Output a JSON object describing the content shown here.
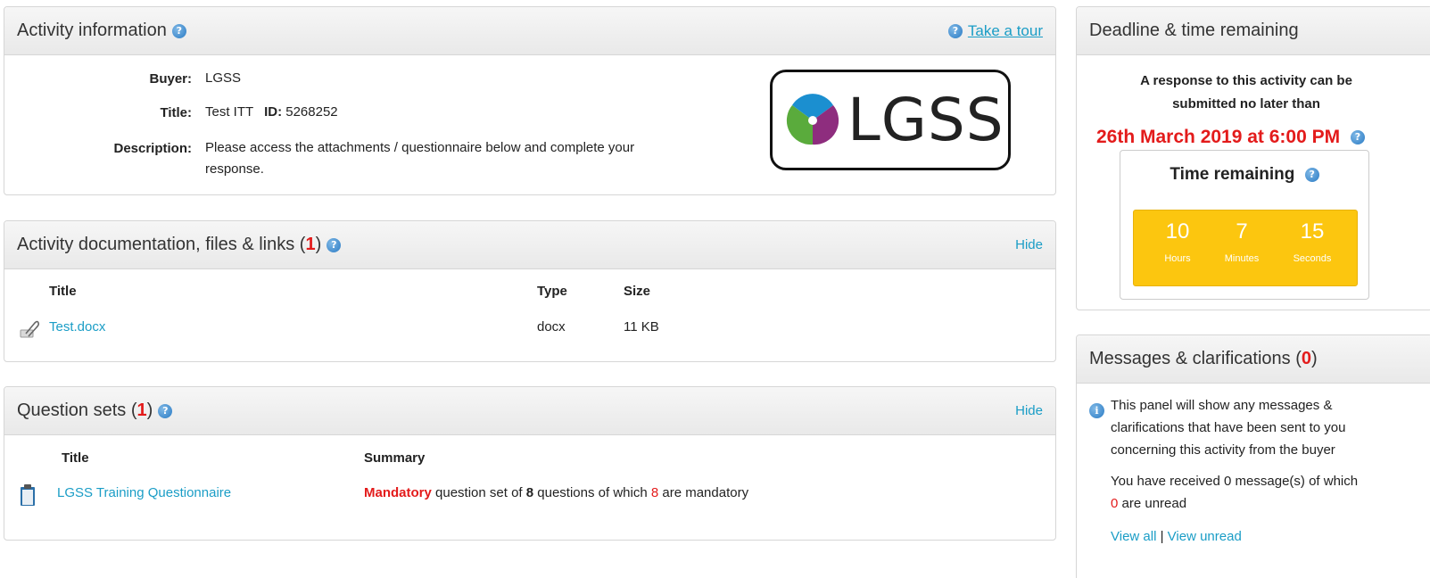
{
  "info": {
    "title": "Activity information",
    "tour_label": "Take a tour",
    "buyer_label": "Buyer:",
    "buyer_value": "LGSS",
    "title_label": "Title:",
    "title_value": "Test ITT",
    "id_label": "ID:",
    "id_value": "5268252",
    "description_label": "Description:",
    "description_line1": "Please access the attachments / questionnaire below and complete your",
    "description_line2": "response.",
    "logo_text": "LGSS"
  },
  "docs": {
    "title_prefix": "Activity documentation, files & links (",
    "count": "1",
    "title_suffix": ")",
    "hide_label": "Hide",
    "col_title": "Title",
    "col_type": "Type",
    "col_size": "Size",
    "rows": [
      {
        "name": "Test.docx",
        "type": "docx",
        "size": "11 KB"
      }
    ]
  },
  "questions": {
    "title_prefix": "Question sets (",
    "count": "1",
    "title_suffix": ")",
    "hide_label": "Hide",
    "col_title": "Title",
    "col_summary": "Summary",
    "rows": [
      {
        "name": "LGSS Training Questionnaire",
        "mandatory": "Mandatory",
        "summary_a": " question set of ",
        "total": "8",
        "summary_b": " questions of which ",
        "mandatory_count": "8",
        "summary_c": " are mandatory"
      }
    ]
  },
  "deadline": {
    "title": "Deadline & time remaining",
    "text_line1": "A response to this activity can be",
    "text_line2": "submitted no later than",
    "date": "26th March 2019 at 6:00 PM",
    "remaining_title": "Time remaining",
    "hours": "10",
    "hours_label": "Hours",
    "minutes": "7",
    "minutes_label": "Minutes",
    "seconds": "15",
    "seconds_label": "Seconds"
  },
  "messages": {
    "title_prefix": "Messages & clarifications (",
    "count": "0",
    "title_suffix": ")",
    "info_line1": "This panel will show any messages &",
    "info_line2": "clarifications that have been sent to you",
    "info_line3": "concerning this activity from the buyer",
    "received_text": "You have received 0 message(s) of which",
    "unread_count": "0",
    "unread_suffix": " are unread",
    "view_all": "View all",
    "separator": "|",
    "view_unread": "View unread"
  },
  "colors": {
    "accent_link": "#1a9dc6",
    "alert_red": "#e31b1b",
    "timer_yellow": "#fcc60f",
    "logo_blue": "#1b8fd0",
    "logo_green": "#5aab3c",
    "logo_purple": "#8e2d7e"
  }
}
